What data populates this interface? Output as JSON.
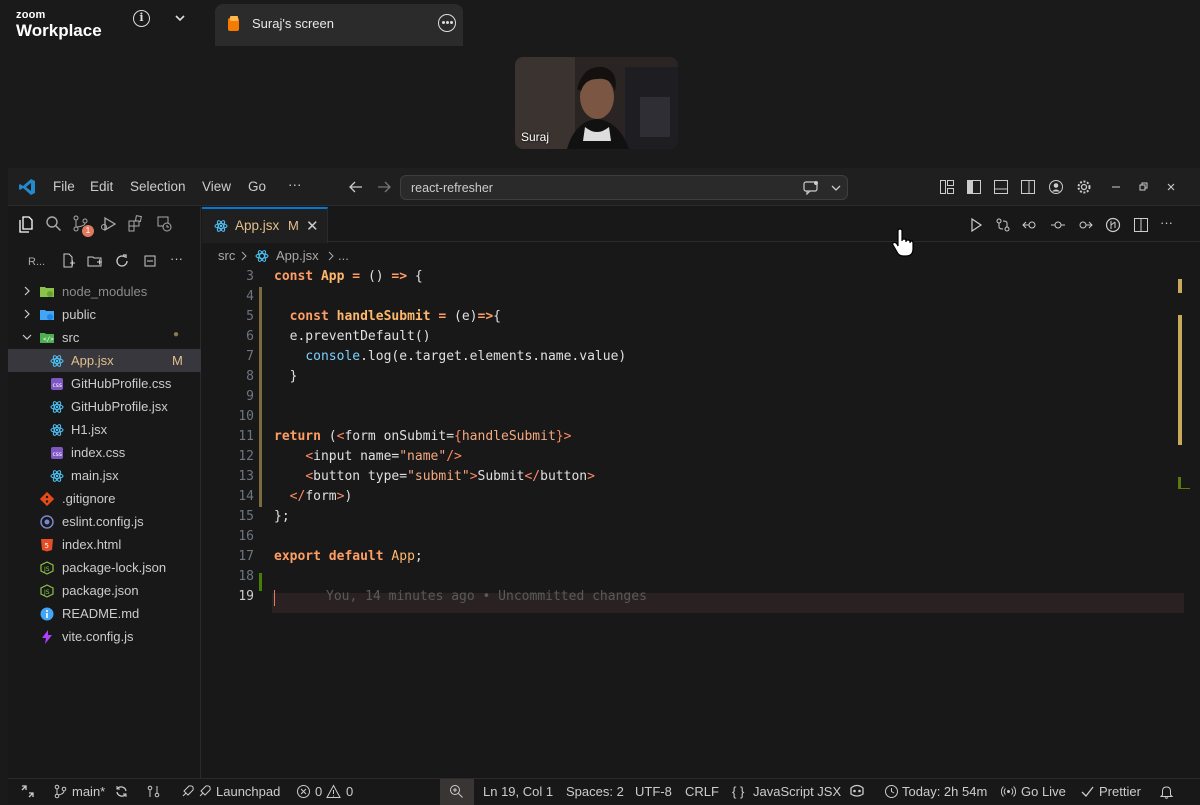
{
  "zoom": {
    "brand_top": "zoom",
    "brand_bottom": "Workplace",
    "tab_label": "Suraj's screen",
    "participant_name": "Suraj"
  },
  "vscode": {
    "menu": [
      "File",
      "Edit",
      "Selection",
      "View",
      "Go",
      "···"
    ],
    "command_center": "react-refresher",
    "explorer": {
      "root_label": "R...",
      "items": [
        {
          "label": "node_modules",
          "type": "folder",
          "icon": "folder-node-icon",
          "color": "#8bc34a"
        },
        {
          "label": "public",
          "type": "folder",
          "icon": "folder-public-icon",
          "color": "#42a5f5"
        },
        {
          "label": "src",
          "type": "folder-open",
          "icon": "folder-src-icon",
          "color": "#4caf50",
          "dot": "●"
        },
        {
          "label": "App.jsx",
          "type": "file",
          "icon": "react-icon",
          "badge": "M",
          "active": true
        },
        {
          "label": "GitHubProfile.css",
          "type": "file",
          "icon": "css-icon"
        },
        {
          "label": "GitHubProfile.jsx",
          "type": "file",
          "icon": "react-icon"
        },
        {
          "label": "H1.jsx",
          "type": "file",
          "icon": "react-icon"
        },
        {
          "label": "index.css",
          "type": "file",
          "icon": "css-icon"
        },
        {
          "label": "main.jsx",
          "type": "file",
          "icon": "react-icon"
        },
        {
          "label": ".gitignore",
          "type": "file",
          "icon": "git-icon"
        },
        {
          "label": "eslint.config.js",
          "type": "file",
          "icon": "eslint-icon"
        },
        {
          "label": "index.html",
          "type": "file",
          "icon": "html-icon"
        },
        {
          "label": "package-lock.json",
          "type": "file",
          "icon": "node-icon"
        },
        {
          "label": "package.json",
          "type": "file",
          "icon": "node-icon"
        },
        {
          "label": "README.md",
          "type": "file",
          "icon": "info-icon"
        },
        {
          "label": "vite.config.js",
          "type": "file",
          "icon": "vite-icon"
        }
      ]
    },
    "scm_badge": "1",
    "tab": {
      "label": "App.jsx",
      "modified": "M",
      "close": "✕"
    },
    "breadcrumb": {
      "folder": "src",
      "file": "App.jsx",
      "more": "..."
    },
    "code": {
      "line_numbers": [
        "3",
        "4",
        "5",
        "6",
        "7",
        "8",
        "9",
        "10",
        "11",
        "12",
        "13",
        "14",
        "15",
        "16",
        "17",
        "18",
        "19"
      ],
      "blame": "You, 14 minutes ago • Uncommitted changes"
    },
    "status": {
      "branch": "main*",
      "launchpad": "Launchpad",
      "errors": "0",
      "warnings": "0",
      "position": "Ln 19, Col 1",
      "spaces": "Spaces: 2",
      "encoding": "UTF-8",
      "eol": "CRLF",
      "language_brace": "{ }",
      "language": "JavaScript JSX",
      "time": "Today: 2h 54m",
      "golive": "Go Live",
      "prettier": "Prettier"
    },
    "colors": {
      "accent": "#0078d4",
      "modified": "#e2c08d",
      "keyword": "#ff9e64"
    }
  }
}
